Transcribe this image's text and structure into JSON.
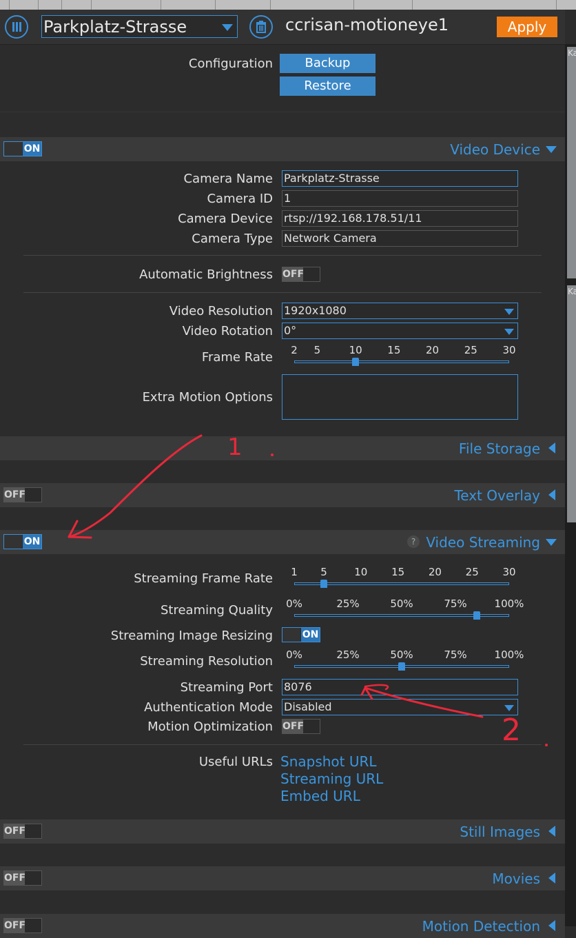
{
  "header": {
    "camera_select": "Parkplatz-Strasse",
    "host": "ccrisan-motioneye1",
    "apply": "Apply"
  },
  "config": {
    "label": "Configuration",
    "backup": "Backup",
    "restore": "Restore"
  },
  "video_device": {
    "title": "Video Device",
    "toggle": "ON",
    "camera_name_label": "Camera Name",
    "camera_name": "Parkplatz-Strasse",
    "camera_id_label": "Camera ID",
    "camera_id": "1",
    "camera_device_label": "Camera Device",
    "camera_device": "rtsp://192.168.178.51/11",
    "camera_type_label": "Camera Type",
    "camera_type": "Network Camera",
    "auto_brightness_label": "Automatic Brightness",
    "auto_brightness": "OFF",
    "resolution_label": "Video Resolution",
    "resolution": "1920x1080",
    "rotation_label": "Video Rotation",
    "rotation": "0°",
    "frame_rate_label": "Frame Rate",
    "frame_rate_ticks": [
      "2",
      "5",
      "10",
      "15",
      "20",
      "25",
      "30"
    ],
    "frame_rate_value": 10,
    "extra_motion_label": "Extra Motion Options"
  },
  "file_storage": {
    "title": "File Storage"
  },
  "text_overlay": {
    "title": "Text Overlay",
    "toggle": "OFF"
  },
  "video_streaming": {
    "title": "Video Streaming",
    "help": "?",
    "toggle": "ON",
    "frame_rate_label": "Streaming Frame Rate",
    "frame_rate_ticks": [
      "1",
      "5",
      "10",
      "15",
      "20",
      "25",
      "30"
    ],
    "frame_rate_value": 5,
    "quality_label": "Streaming Quality",
    "quality_ticks": [
      "0%",
      "25%",
      "50%",
      "75%",
      "100%"
    ],
    "quality_value": 85,
    "resizing_label": "Streaming Image Resizing",
    "resizing": "ON",
    "resolution_label": "Streaming Resolution",
    "resolution_ticks": [
      "0%",
      "25%",
      "50%",
      "75%",
      "100%"
    ],
    "resolution_value": 50,
    "port_label": "Streaming Port",
    "port": "8076",
    "auth_label": "Authentication Mode",
    "auth": "Disabled",
    "motion_opt_label": "Motion Optimization",
    "motion_opt": "OFF",
    "urls_label": "Useful URLs",
    "snapshot_url": "Snapshot URL",
    "streaming_url": "Streaming URL",
    "embed_url": "Embed URL"
  },
  "still_images": {
    "title": "Still Images",
    "toggle": "OFF"
  },
  "movies": {
    "title": "Movies",
    "toggle": "OFF"
  },
  "motion_detection": {
    "title": "Motion Detection",
    "toggle": "OFF"
  },
  "previews": {
    "label_1": "Ka",
    "label_2": "Ka"
  },
  "annotations": {
    "mark_1": "1",
    "mark_2": "2"
  }
}
